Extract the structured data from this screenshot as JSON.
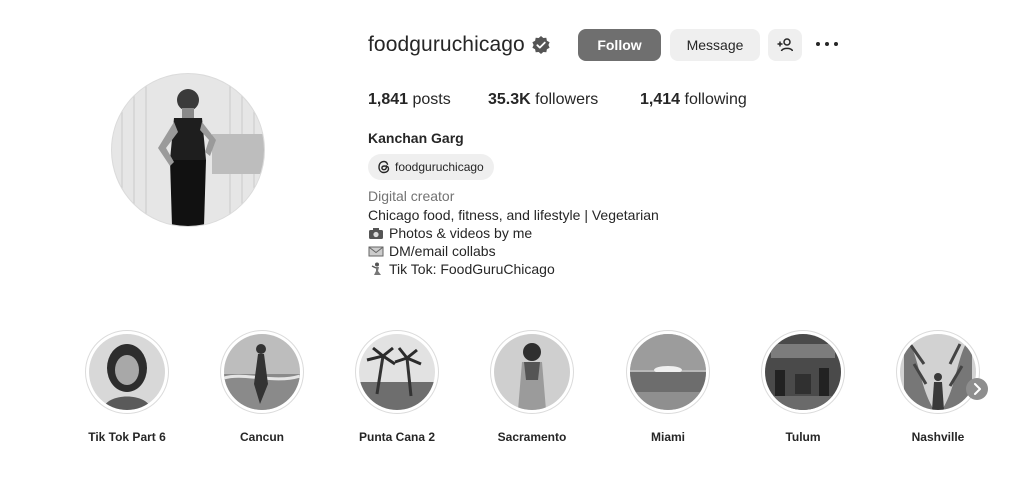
{
  "profile": {
    "username": "foodguruchicago",
    "verified": true,
    "full_name": "Kanchan Garg",
    "threads_handle": "foodguruchicago",
    "category": "Digital creator",
    "bio": [
      {
        "text": "Chicago food, fitness, and lifestyle | Vegetarian",
        "emoji": ""
      },
      {
        "text": "Photos & videos by me",
        "emoji": "camera-emoji"
      },
      {
        "text": "DM/email collabs",
        "emoji": "envelope-emoji"
      },
      {
        "text": "Tik Tok: FoodGuruChicago",
        "emoji": "dancer-emoji"
      }
    ]
  },
  "actions": {
    "follow_label": "Follow",
    "message_label": "Message",
    "add_icon": "add-person-icon",
    "more_icon": "more-options-icon"
  },
  "stats": {
    "posts_count": "1,841",
    "posts_label": "posts",
    "followers_count": "35.3K",
    "followers_label": "followers",
    "following_count": "1,414",
    "following_label": "following"
  },
  "highlights": [
    {
      "label": "Tik Tok Part 6"
    },
    {
      "label": "Cancun"
    },
    {
      "label": "Punta Cana 2"
    },
    {
      "label": "Sacramento"
    },
    {
      "label": "Miami"
    },
    {
      "label": "Tulum"
    },
    {
      "label": "Nashville"
    }
  ],
  "colors": {
    "follow_button": "#6f6f6f",
    "secondary_button": "#efefef",
    "text_primary": "#262626",
    "text_secondary": "#737373",
    "ring_border": "#dbdbdb"
  }
}
